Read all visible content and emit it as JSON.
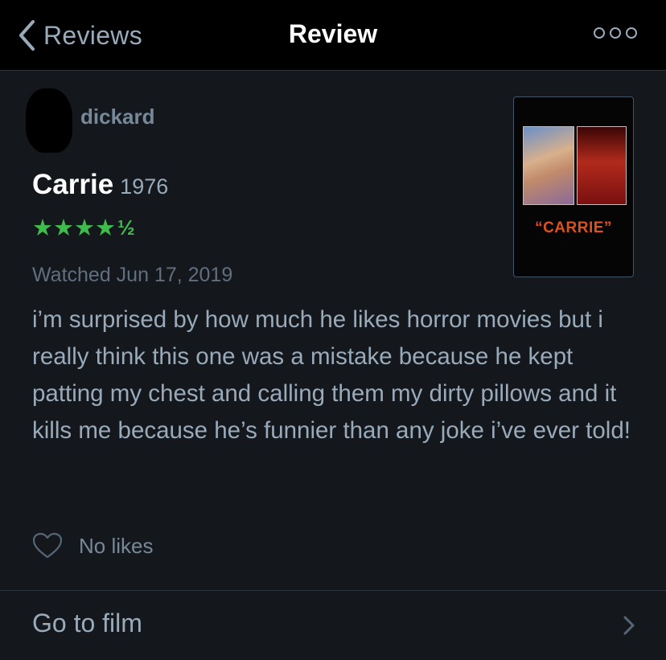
{
  "nav": {
    "back_label": "Reviews",
    "title": "Review"
  },
  "review": {
    "username": "dickard",
    "film_title": "Carrie",
    "film_year": "1976",
    "rating": 4.5,
    "stars_display": "★★★★",
    "half_display": "½",
    "watched": "Watched Jun 17, 2019",
    "body": "i’m surprised by how much he likes horror movies but i really think this one was a mistake because he kept patting my chest and calling them my dirty pillows and it kills me because he’s funnier than any joke i’ve ever told!"
  },
  "poster": {
    "title_text": "“CARRIE”"
  },
  "likes": {
    "label": "No likes"
  },
  "footer": {
    "goto_label": "Go to film"
  },
  "colors": {
    "background": "#14181c",
    "navbar": "#000000",
    "star_green": "#40bc4c",
    "text_muted": "#99aabb"
  },
  "icons": {
    "back": "chevron-left-icon",
    "more": "more-horizontal-icon",
    "like": "heart-outline-icon",
    "goto": "chevron-right-icon"
  }
}
